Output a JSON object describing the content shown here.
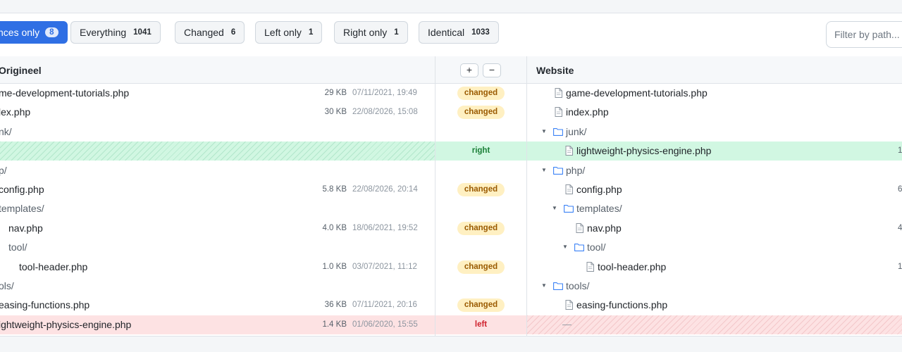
{
  "filters": [
    {
      "label": "nces only",
      "count": "8",
      "active": true
    },
    {
      "label": "Everything",
      "count": "1041",
      "active": false
    },
    {
      "label": "Changed",
      "count": "6",
      "active": false
    },
    {
      "label": "Left only",
      "count": "1",
      "active": false
    },
    {
      "label": "Right only",
      "count": "1",
      "active": false
    },
    {
      "label": "Identical",
      "count": "1033",
      "active": false
    }
  ],
  "search": {
    "placeholder": "Filter by path..."
  },
  "header": {
    "left_title": "Origineel",
    "right_title": "Website",
    "expand_label": "+",
    "collapse_label": "−"
  },
  "colors": {
    "accent": "#2f6fe4",
    "changed_bg": "#fff0c2",
    "changed_text": "#9a5a00",
    "right_only_bg": "#d1f7e2",
    "right_only_text": "#1a7f37",
    "left_only_bg": "#fde2e3",
    "left_only_text": "#cf222e",
    "folder": "#3b82f6"
  },
  "rows": [
    {
      "kind": "file",
      "left_name": "me-development-tutorials.php",
      "left_size": "29 KB",
      "left_date": "07/11/2021, 19:49",
      "status": "changed",
      "right_name": "game-development-tutorials.php",
      "right_size": ""
    },
    {
      "kind": "file",
      "left_name": "lex.php",
      "left_size": "30 KB",
      "left_date": "22/08/2026, 15:08",
      "status": "changed",
      "right_name": "index.php",
      "right_size": ""
    },
    {
      "kind": "dir",
      "left_name": "nk/",
      "left_size": "",
      "left_date": "",
      "status": "",
      "right_name": "junk/",
      "right_size": ""
    },
    {
      "kind": "file",
      "left_name": "",
      "left_size": "",
      "left_date": "",
      "status": "right",
      "right_name": "lightweight-physics-engine.php",
      "right_size": "1"
    },
    {
      "kind": "dir",
      "left_name": "p/",
      "left_size": "",
      "left_date": "",
      "status": "",
      "right_name": "php/",
      "right_size": ""
    },
    {
      "kind": "file",
      "left_name": "config.php",
      "left_size": "5.8 KB",
      "left_date": "22/08/2026, 20:14",
      "status": "changed",
      "right_name": "config.php",
      "right_size": "6"
    },
    {
      "kind": "dir",
      "left_name": "templates/",
      "left_size": "",
      "left_date": "",
      "status": "",
      "right_name": "templates/",
      "right_size": ""
    },
    {
      "kind": "file",
      "left_name": "nav.php",
      "left_size": "4.0 KB",
      "left_date": "18/06/2021, 19:52",
      "status": "changed",
      "right_name": "nav.php",
      "right_size": "4"
    },
    {
      "kind": "dir",
      "left_name": "tool/",
      "left_size": "",
      "left_date": "",
      "status": "",
      "right_name": "tool/",
      "right_size": ""
    },
    {
      "kind": "file",
      "left_name": "tool-header.php",
      "left_size": "1.0 KB",
      "left_date": "03/07/2021, 11:12",
      "status": "changed",
      "right_name": "tool-header.php",
      "right_size": "1"
    },
    {
      "kind": "dir",
      "left_name": "ols/",
      "left_size": "",
      "left_date": "",
      "status": "",
      "right_name": "tools/",
      "right_size": ""
    },
    {
      "kind": "file",
      "left_name": "easing-functions.php",
      "left_size": "36 KB",
      "left_date": "07/11/2021, 20:16",
      "status": "changed",
      "right_name": "easing-functions.php",
      "right_size": ""
    },
    {
      "kind": "file",
      "left_name": "ightweight-physics-engine.php",
      "left_size": "1.4 KB",
      "left_date": "01/06/2020, 15:55",
      "status": "left",
      "right_name": "—",
      "right_size": ""
    }
  ]
}
